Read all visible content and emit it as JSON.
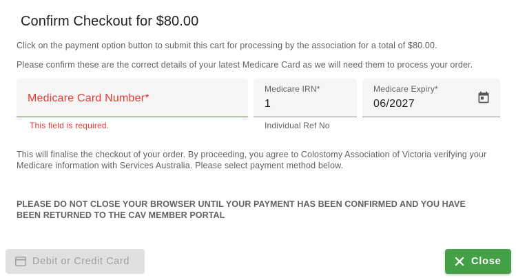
{
  "dialog": {
    "title": "Confirm Checkout for $80.00",
    "intro_line_1": "Click on the payment option button to submit this cart for processing by the association for a total of $80.00.",
    "intro_line_2": "Please confirm these are the correct details of your latest Medicare Card as we will need them to process your order.",
    "consent_text": "This will finalise the checkout of your order. By proceeding, you agree to Colostomy Association of Victoria verifying your Medicare information with Services Australia. Please select payment method below.",
    "warning_text": "PLEASE DO NOT CLOSE YOUR BROWSER UNTIL YOUR PAYMENT HAS BEEN CONFIRMED AND YOU HAVE BEEN RETURNED TO THE CAV MEMBER PORTAL"
  },
  "form": {
    "medicare_card": {
      "label": "Medicare Card Number*",
      "value": "",
      "error": "This field is required."
    },
    "medicare_irn": {
      "label": "Medicare IRN*",
      "value": "1",
      "hint": "Individual Ref No"
    },
    "medicare_expiry": {
      "label": "Medicare Expiry*",
      "value": "06/2027",
      "icon": "calendar-icon"
    }
  },
  "actions": {
    "pay_label": "Debit or Credit Card",
    "pay_icon": "credit-card-icon",
    "close_label": "Close",
    "close_icon": "close-icon"
  },
  "colors": {
    "error": "#e53935",
    "success": "#43a047",
    "disabled_bg": "#e0e0e0"
  }
}
